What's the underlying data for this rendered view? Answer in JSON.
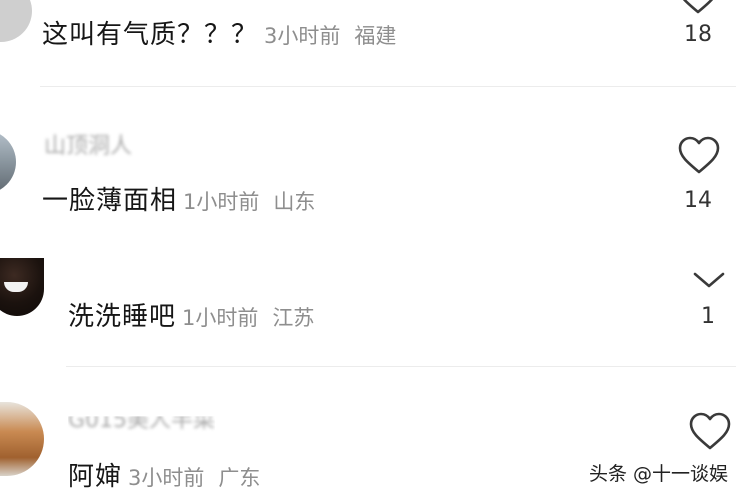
{
  "comments": [
    {
      "username": "",
      "text": "这叫有气质？？？",
      "time": "3小时前",
      "location": "福建",
      "likes": "18"
    },
    {
      "username": "山顶洞人",
      "text": "一脸薄面相",
      "time": "1小时前",
      "location": "山东",
      "likes": "14"
    },
    {
      "username": "",
      "text": "洗洗睡吧",
      "time": "1小时前",
      "location": "江苏",
      "likes": "1"
    },
    {
      "username": "G015美人半菜",
      "text": "阿婶",
      "time": "3小时前",
      "location": "广东",
      "likes": ""
    }
  ],
  "watermark": "头条 @十一谈娱",
  "colors": {
    "text": "#161616",
    "meta": "#8e8e8e",
    "divider": "#ececec",
    "heart": "#3a3a3a"
  },
  "icons": {
    "like": "heart-outline-icon",
    "collapse": "chevron-down-icon"
  }
}
